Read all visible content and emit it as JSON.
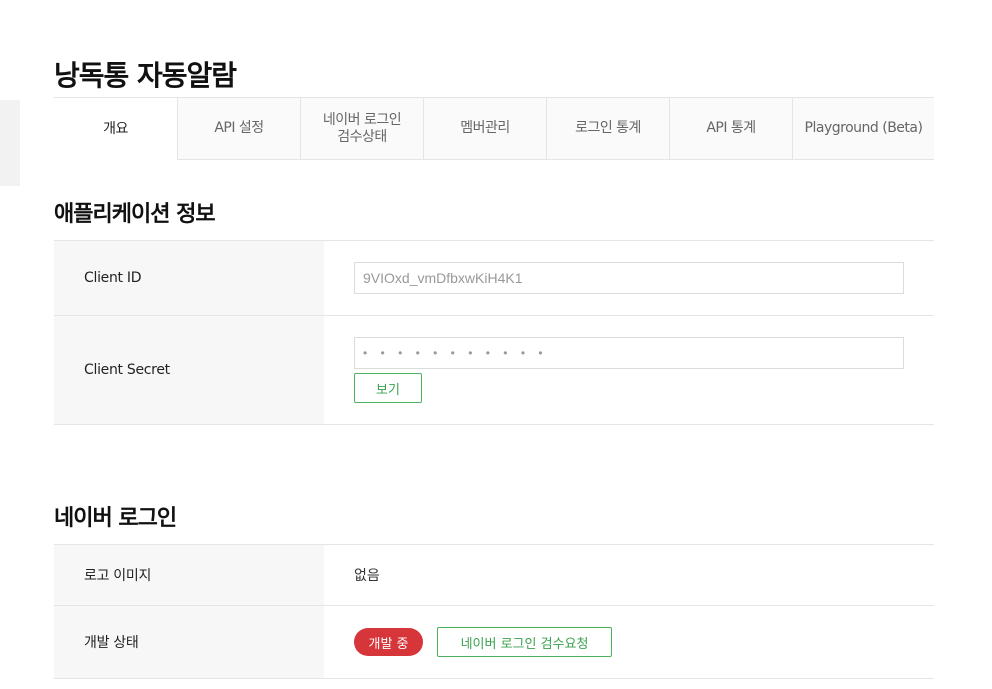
{
  "page": {
    "title": "낭독통 자동알람"
  },
  "tabs": [
    {
      "label": "개요"
    },
    {
      "label": "API 설정"
    },
    {
      "label_line1": "네이버 로그인",
      "label_line2": "검수상태"
    },
    {
      "label": "멤버관리"
    },
    {
      "label": "로그인 통계"
    },
    {
      "label": "API 통계"
    },
    {
      "label": "Playground (Beta)"
    }
  ],
  "app_info": {
    "title": "애플리케이션 정보",
    "client_id_label": "Client ID",
    "client_id_value": "9VIOxd_vmDfbxwKiH4K1",
    "client_secret_label": "Client Secret",
    "client_secret_value": "• • • • • • • • • • •",
    "show_button": "보기"
  },
  "naver_login": {
    "title": "네이버 로그인",
    "logo_image_label": "로고 이미지",
    "logo_image_value": "없음",
    "dev_status_label": "개발 상태",
    "dev_status_badge": "개발 중",
    "review_request_button": "네이버 로그인 검수요청"
  },
  "colors": {
    "accent_green": "#3aa24e",
    "badge_red": "#d6353a"
  }
}
